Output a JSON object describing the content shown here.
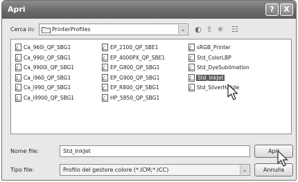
{
  "window": {
    "title": "Apri",
    "help_glyph": "?",
    "close_glyph": "X"
  },
  "lookin": {
    "label": "Cerca in:",
    "folder": "PrinterProfiles",
    "arrow": "⌄"
  },
  "toolbar": {
    "back_glyph": "◐",
    "up_glyph": "⇧",
    "newfolder_glyph": "✳",
    "view_glyph": "☷"
  },
  "files": [
    "Ca_960i_QP_SBG1",
    "Ca_990i_QP_SBG1",
    "Ca_9900i_QP_SBG1",
    "Ca_i960_QP_SBG1",
    "Ca_i990_QP_SBG1",
    "Ca_i9900_QP_SBG1",
    "EP_2100_QP_SBE1",
    "EP_4000PX_QP_SBE1",
    "EP_G800_QP_SBG1",
    "EP_G900_QP_SBG1",
    "EP_R800_QP_SBG1",
    "HP_5850_QP_SBG1",
    "sRGB_Printer",
    "Std_ColorLBP",
    "Std_DyeSublimation",
    "Std_InkJet",
    "Std_SilverHalide"
  ],
  "selected_file": "Std_InkJet",
  "filename": {
    "label": "Nome file:",
    "value": "Std_InkJet"
  },
  "filetype": {
    "label": "Tipo file:",
    "value": "Profilo del gestore colore (*.ICM;*.ICC)",
    "arrow": "⌄"
  },
  "buttons": {
    "open": "Apri",
    "cancel": "Annulla"
  }
}
